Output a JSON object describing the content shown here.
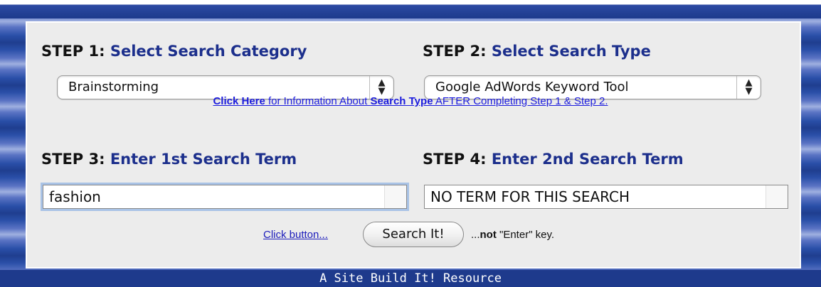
{
  "step1": {
    "label": "STEP 1:",
    "title": "Select Search Category",
    "selected": "Brainstorming"
  },
  "step2": {
    "label": "STEP 2:",
    "title": "Select Search Type",
    "selected": "Google AdWords Keyword Tool"
  },
  "info": {
    "link_text": "Click  Here",
    "text1": " for Information About ",
    "bold_text": "Search Type",
    "text2": " AFTER Completing Step 1 & Step 2."
  },
  "step3": {
    "label": "STEP 3:",
    "title": "Enter 1st Search Term",
    "value": "fashion"
  },
  "step4": {
    "label": "STEP 4:",
    "title": "Enter 2nd Search Term",
    "value": "NO TERM FOR THIS SEARCH"
  },
  "action": {
    "prefix": "Click button...",
    "button": "Search It!",
    "suffix_dots": "...",
    "suffix_bold": "not",
    "suffix_rest": " \"Enter\" key."
  },
  "footer": {
    "text": "A Site Build It! Resource"
  },
  "icons": {
    "select_arrows": "up-down-arrows-icon"
  }
}
